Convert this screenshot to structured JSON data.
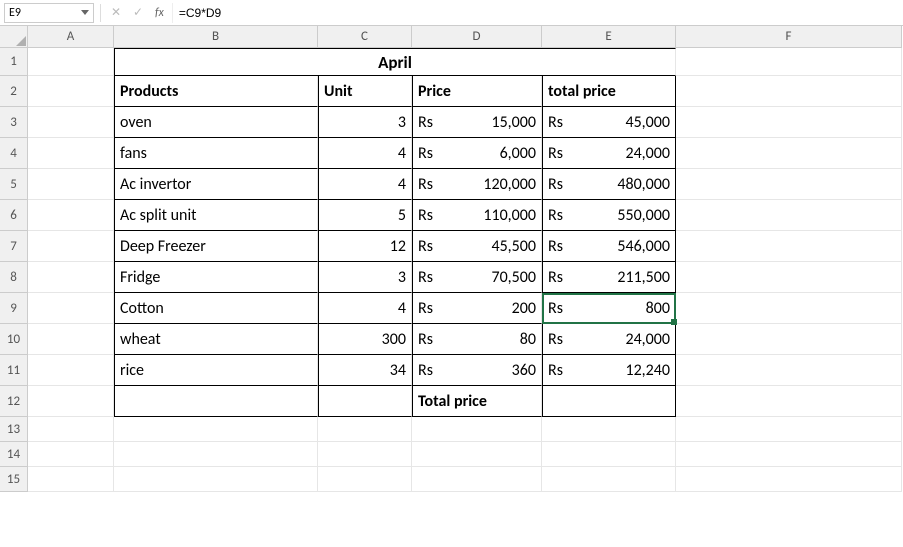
{
  "formula_bar": {
    "cell_ref": "E9",
    "formula": "=C9*D9",
    "fx_label": "fx"
  },
  "columns": [
    "A",
    "B",
    "C",
    "D",
    "E",
    "F"
  ],
  "rows": [
    "1",
    "2",
    "3",
    "4",
    "5",
    "6",
    "7",
    "8",
    "9",
    "10",
    "11",
    "12",
    "13",
    "14",
    "15"
  ],
  "title": "April",
  "headers": {
    "products": "Products",
    "unit": "Unit",
    "price": "Price",
    "total": "total price"
  },
  "table": [
    {
      "product": "oven",
      "unit": "3",
      "price_cur": "Rs",
      "price_amt": "15,000",
      "tot_cur": "Rs",
      "tot_amt": "45,000"
    },
    {
      "product": "fans",
      "unit": "4",
      "price_cur": "Rs",
      "price_amt": "6,000",
      "tot_cur": "Rs",
      "tot_amt": "24,000"
    },
    {
      "product": "Ac invertor",
      "unit": "4",
      "price_cur": "Rs",
      "price_amt": "120,000",
      "tot_cur": "Rs",
      "tot_amt": "480,000"
    },
    {
      "product": "Ac split unit",
      "unit": "5",
      "price_cur": "Rs",
      "price_amt": "110,000",
      "tot_cur": "Rs",
      "tot_amt": "550,000"
    },
    {
      "product": "Deep Freezer",
      "unit": "12",
      "price_cur": "Rs",
      "price_amt": "45,500",
      "tot_cur": "Rs",
      "tot_amt": "546,000"
    },
    {
      "product": "Fridge",
      "unit": "3",
      "price_cur": "Rs",
      "price_amt": "70,500",
      "tot_cur": "Rs",
      "tot_amt": "211,500"
    },
    {
      "product": "Cotton",
      "unit": "4",
      "price_cur": "Rs",
      "price_amt": "200",
      "tot_cur": "Rs",
      "tot_amt": "800"
    },
    {
      "product": "wheat",
      "unit": "300",
      "price_cur": "Rs",
      "price_amt": "80",
      "tot_cur": "Rs",
      "tot_amt": "24,000"
    },
    {
      "product": "rice",
      "unit": "34",
      "price_cur": "Rs",
      "price_amt": "360",
      "tot_cur": "Rs",
      "tot_amt": "12,240"
    }
  ],
  "footer": {
    "total_price_label": "Total price"
  },
  "active_cell": "E9"
}
